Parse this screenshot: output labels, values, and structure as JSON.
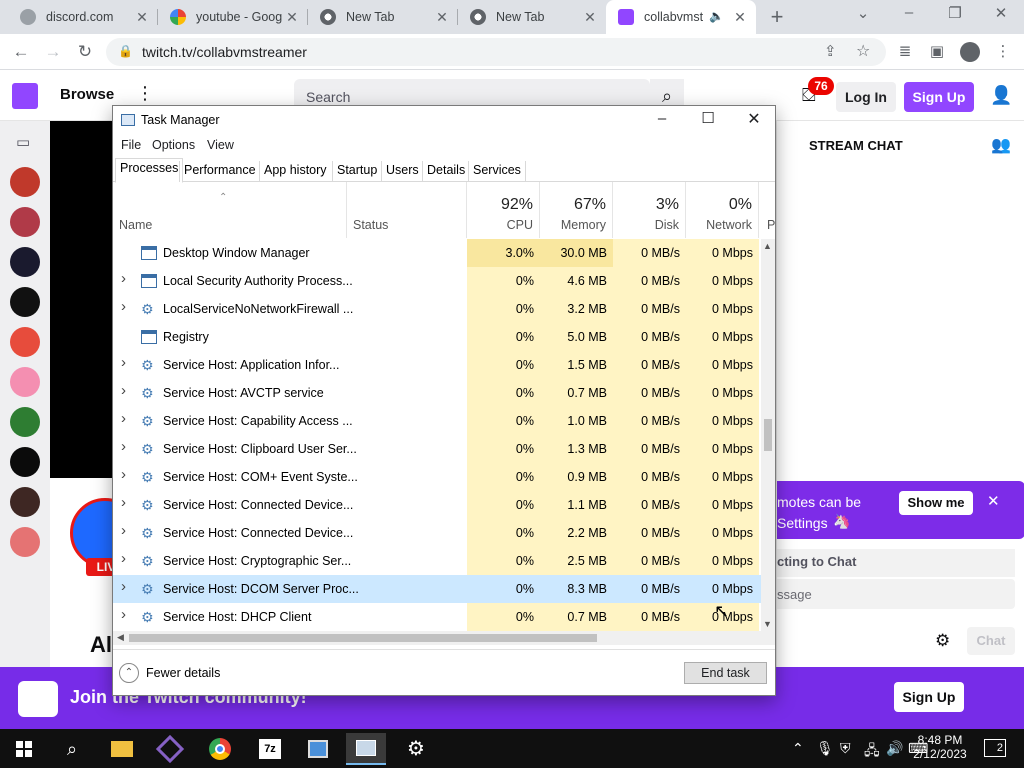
{
  "browser": {
    "tabs": [
      {
        "title": "discord.com",
        "favicon_color": "#5f6368"
      },
      {
        "title": "youtube - Goog",
        "favicon_color": "#4285f4"
      },
      {
        "title": "New Tab",
        "favicon_color": "#5f6368"
      },
      {
        "title": "New Tab",
        "favicon_color": "#5f6368"
      },
      {
        "title": "collabvmst",
        "favicon_color": "#9146ff"
      }
    ],
    "url": "twitch.tv/collabvmstreamer"
  },
  "twitch": {
    "browse_label": "Browse",
    "search_placeholder": "Search",
    "notification_count": "76",
    "login_label": "Log In",
    "signup_label": "Sign Up",
    "chat_header": "STREAM CHAT",
    "emote_text_1": "motes can be",
    "emote_text_2": "Settings",
    "show_me_label": "Show me",
    "connecting_text": "cting to Chat",
    "message_placeholder": "ssage",
    "chat_button": "Chat",
    "live_badge": "LIV",
    "channel_initials": "Al",
    "join_text": "Join the Twitch community!",
    "join_signup": "Sign Up",
    "brand_color": "#9146ff"
  },
  "task_manager": {
    "title": "Task Manager",
    "menu": [
      "File",
      "Options",
      "View"
    ],
    "tabs": [
      "Processes",
      "Performance",
      "App history",
      "Startup",
      "Users",
      "Details",
      "Services"
    ],
    "columns": {
      "name": "Name",
      "status": "Status",
      "cpu": {
        "percent": "92%",
        "label": "CPU"
      },
      "memory": {
        "percent": "67%",
        "label": "Memory"
      },
      "disk": {
        "percent": "3%",
        "label": "Disk"
      },
      "network": {
        "percent": "0%",
        "label": "Network"
      },
      "power": "P"
    },
    "rows": [
      {
        "name": "Desktop Window Manager",
        "cpu": "3.0%",
        "memory": "30.0 MB",
        "disk": "0 MB/s",
        "network": "0 Mbps",
        "expandable": false,
        "icon": "window"
      },
      {
        "name": "Local Security Authority Process...",
        "cpu": "0%",
        "memory": "4.6 MB",
        "disk": "0 MB/s",
        "network": "0 Mbps",
        "expandable": true,
        "icon": "window"
      },
      {
        "name": "LocalServiceNoNetworkFirewall ...",
        "cpu": "0%",
        "memory": "3.2 MB",
        "disk": "0 MB/s",
        "network": "0 Mbps",
        "expandable": true,
        "icon": "gear"
      },
      {
        "name": "Registry",
        "cpu": "0%",
        "memory": "5.0 MB",
        "disk": "0 MB/s",
        "network": "0 Mbps",
        "expandable": false,
        "icon": "window"
      },
      {
        "name": "Service Host: Application Infor...",
        "cpu": "0%",
        "memory": "1.5 MB",
        "disk": "0 MB/s",
        "network": "0 Mbps",
        "expandable": true,
        "icon": "gear"
      },
      {
        "name": "Service Host: AVCTP service",
        "cpu": "0%",
        "memory": "0.7 MB",
        "disk": "0 MB/s",
        "network": "0 Mbps",
        "expandable": true,
        "icon": "gear"
      },
      {
        "name": "Service Host: Capability Access ...",
        "cpu": "0%",
        "memory": "1.0 MB",
        "disk": "0 MB/s",
        "network": "0 Mbps",
        "expandable": true,
        "icon": "gear"
      },
      {
        "name": "Service Host: Clipboard User Ser...",
        "cpu": "0%",
        "memory": "1.3 MB",
        "disk": "0 MB/s",
        "network": "0 Mbps",
        "expandable": true,
        "icon": "gear"
      },
      {
        "name": "Service Host: COM+ Event Syste...",
        "cpu": "0%",
        "memory": "0.9 MB",
        "disk": "0 MB/s",
        "network": "0 Mbps",
        "expandable": true,
        "icon": "gear"
      },
      {
        "name": "Service Host: Connected Device...",
        "cpu": "0%",
        "memory": "1.1 MB",
        "disk": "0 MB/s",
        "network": "0 Mbps",
        "expandable": true,
        "icon": "gear"
      },
      {
        "name": "Service Host: Connected Device...",
        "cpu": "0%",
        "memory": "2.2 MB",
        "disk": "0 MB/s",
        "network": "0 Mbps",
        "expandable": true,
        "icon": "gear"
      },
      {
        "name": "Service Host: Cryptographic Ser...",
        "cpu": "0%",
        "memory": "2.5 MB",
        "disk": "0 MB/s",
        "network": "0 Mbps",
        "expandable": true,
        "icon": "gear"
      },
      {
        "name": "Service Host: DCOM Server Proc...",
        "cpu": "0%",
        "memory": "8.3 MB",
        "disk": "0 MB/s",
        "network": "0 Mbps",
        "expandable": true,
        "icon": "gear",
        "selected": true
      },
      {
        "name": "Service Host: DHCP Client",
        "cpu": "0%",
        "memory": "0.7 MB",
        "disk": "0 MB/s",
        "network": "0 Mbps",
        "expandable": true,
        "icon": "gear"
      }
    ],
    "fewer_details": "Fewer details",
    "end_task": "End task",
    "heat_color": "#fff4c4",
    "heat_color_strong": "#f9e79f",
    "selected_color": "#cce8ff"
  },
  "taskbar": {
    "time": "8:48 PM",
    "date": "2/12/2023",
    "notification_count": "2"
  }
}
